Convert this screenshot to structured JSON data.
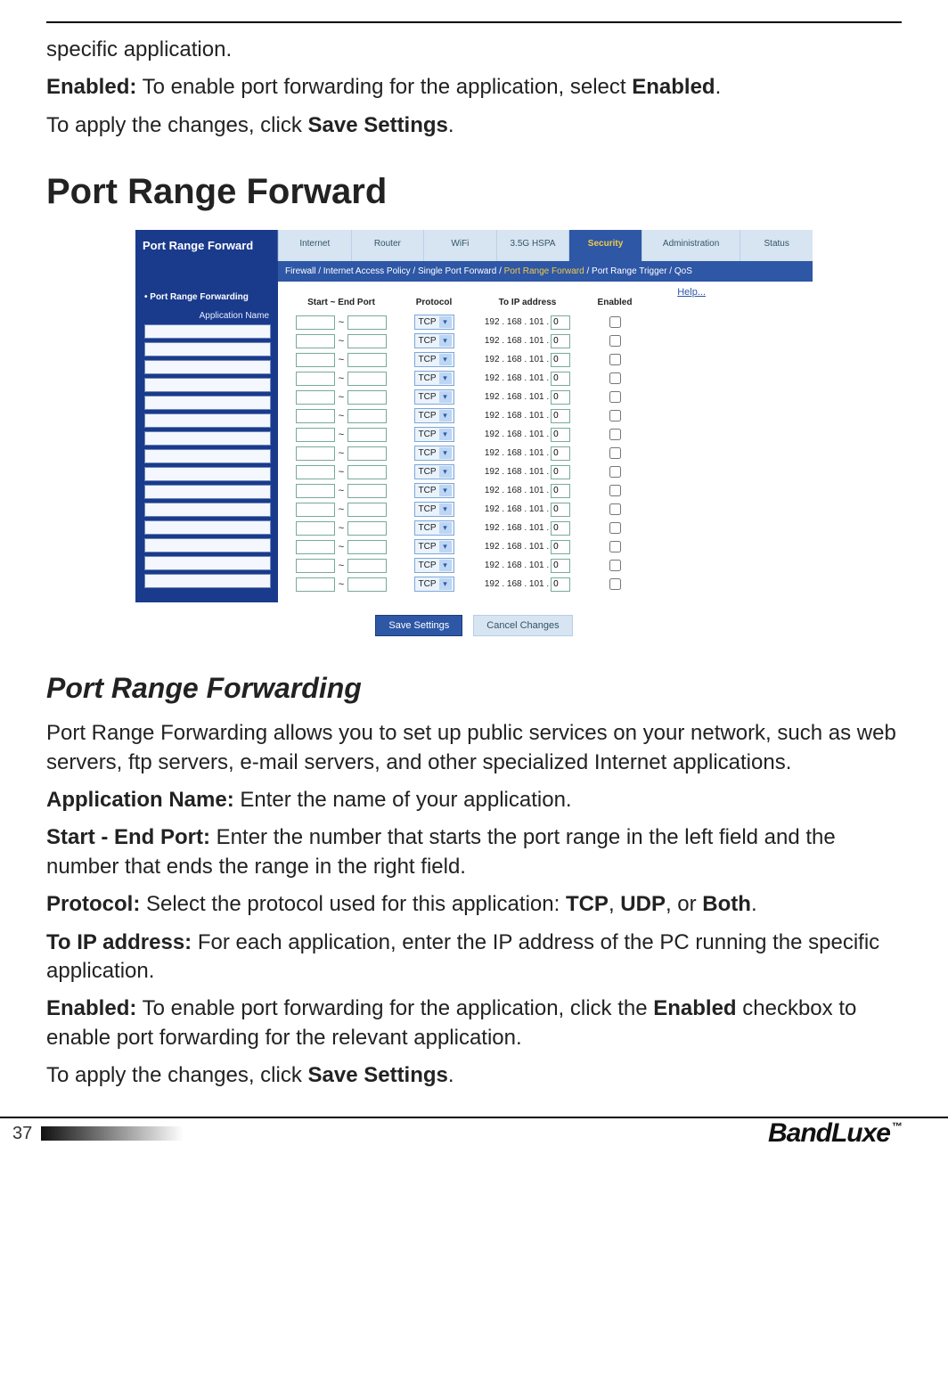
{
  "doc": {
    "para_specific": "specific application.",
    "enabled_label": "Enabled:",
    "enabled_text": " To enable port forwarding for the application, select ",
    "enabled_bold": "Enabled",
    "period": ".",
    "apply_prefix": "To apply the changes, click ",
    "apply_bold": "Save Settings",
    "h1": "Port Range Forward",
    "h2": "Port Range Forwarding",
    "p_intro": "Port Range Forwarding allows you to set up public services on your network, such as web servers, ftp servers, e-mail servers, and other specialized Internet applications.",
    "p_app_label": "Application Name:",
    "p_app_text": " Enter the name of your application.",
    "p_port_label": "Start - End Port:",
    "p_port_text": " Enter the number that starts the port range in the left field and the number that ends the range in the right field.",
    "p_proto_label": "Protocol:",
    "p_proto_text_a": " Select the protocol used for this application: ",
    "p_proto_tcp": "TCP",
    "p_proto_sep": ", ",
    "p_proto_udp": "UDP",
    "p_proto_or": ", or ",
    "p_proto_both": "Both",
    "p_ip_label": "To IP address:",
    "p_ip_text": " For each application, enter the IP address of the PC running the specific application.",
    "p_en_label": "Enabled:",
    "p_en_text_a": " To enable port forwarding for the application, click the ",
    "p_en_bold": "Enabled",
    "p_en_text_b": " checkbox to enable port forwarding for the relevant application.",
    "page_number": "37",
    "brand_logo": "BandLuxe",
    "tm": "™"
  },
  "shot": {
    "brand": "Port Range Forward",
    "tabs": [
      "Internet",
      "Router",
      "WiFi",
      "3.5G HSPA",
      "Security",
      "Administration",
      "Status"
    ],
    "subnav_pre": "Firewall  /  Internet Access Policy  /  Single Port Forward / ",
    "subnav_active": "Port Range Forward",
    "subnav_post": " /  Port Range Trigger  /  QoS",
    "side_section": "Port Range Forwarding",
    "side_label": "Application Name",
    "help": "Help...",
    "headers": {
      "ports": "Start ~ End Port",
      "proto": "Protocol",
      "ip": "To IP address",
      "en": "Enabled"
    },
    "protocol_value": "TCP",
    "ip_prefix": "192 . 168 . 101 .",
    "ip_last": "0",
    "row_count": 15,
    "save": "Save Settings",
    "cancel": "Cancel Changes"
  }
}
